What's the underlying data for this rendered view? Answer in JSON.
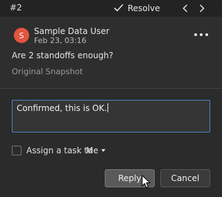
{
  "header": {
    "comment_number": "#2",
    "resolve_label": "Resolve"
  },
  "comment": {
    "avatar_initial": "S",
    "author": "Sample Data User",
    "date": "Feb 23, 03:16",
    "message": "Are 2 standoffs enough?",
    "snapshot_label": "Original Snapshot"
  },
  "reply": {
    "text": "Confirmed, this is OK.",
    "assign_label": "Assign a task to",
    "assignee": "Me",
    "assign_checked": false,
    "reply_button": "Reply",
    "cancel_button": "Cancel"
  },
  "colors": {
    "avatar": "#e2553f",
    "focus_border": "#4f86c6"
  },
  "icons": [
    "check-icon",
    "chevron-left-icon",
    "chevron-right-icon",
    "more-icon",
    "caret-down-icon",
    "mouse-cursor-icon"
  ]
}
